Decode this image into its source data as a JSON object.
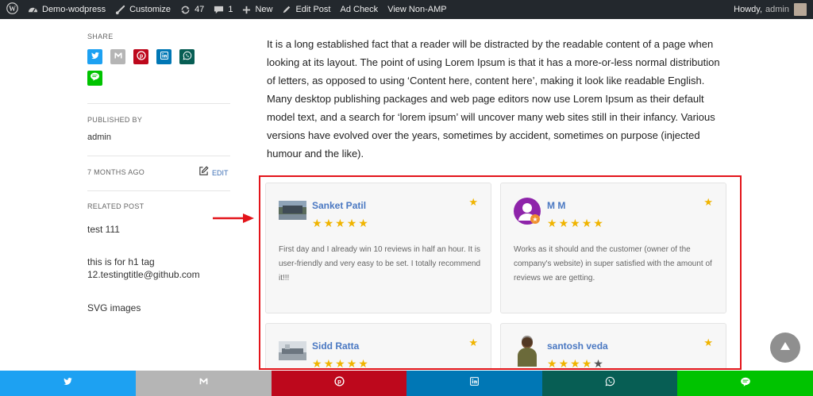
{
  "admin_bar": {
    "site_name": "Demo-wodpress",
    "customize": "Customize",
    "updates_count": "47",
    "comments_count": "1",
    "new": "New",
    "edit_post": "Edit Post",
    "ad_check": "Ad Check",
    "view_non_amp": "View Non-AMP",
    "howdy": "Howdy,",
    "user": "admin"
  },
  "sidebar": {
    "share_label": "SHARE",
    "share_icons": [
      "twitter-icon",
      "gmail-icon",
      "pinterest-icon",
      "linkedin-icon",
      "whatsapp-icon",
      "line-icon"
    ],
    "published_by_label": "PUBLISHED BY",
    "author": "admin",
    "date": "7 MONTHS AGO",
    "edit_label": "EDIT",
    "related_label": "RELATED POST",
    "related_posts": [
      "test 111",
      "this is for h1 tag 12.testingtitle@github.com",
      "SVG images"
    ]
  },
  "article": {
    "body": "It is a long established fact that a reader will be distracted by the readable content of a page when looking at its layout. The point of using Lorem Ipsum is that it has a more-or-less normal distribution of letters, as opposed to using ‘Content here, content here’, making it look like readable English. Many desktop publishing packages and web page editors now use Lorem Ipsum as their default model text, and a search for ‘lorem ipsum’ will uncover many web sites still in their infancy. Various versions have evolved over the years, sometimes by accident, sometimes on purpose (injected humour and the like)."
  },
  "reviews": [
    {
      "name": "Sanket Patil",
      "rating": 5,
      "text": "First day and I already win 10 reviews in half an hour. It is user-friendly and very easy to be set. I totally recommend it!!!"
    },
    {
      "name": "M M",
      "rating": 5,
      "text": "Works as it should and the customer (owner of the company's website) in super satisfied with the amount of reviews we are getting."
    },
    {
      "name": "Sidd Ratta",
      "rating": 5,
      "text": ""
    },
    {
      "name": "santosh veda",
      "rating": 4,
      "text": ""
    }
  ],
  "share_bar": [
    "twitter-icon",
    "gmail-icon",
    "pinterest-icon",
    "linkedin-icon",
    "whatsapp-icon",
    "line-icon"
  ],
  "colors": {
    "admin_bar": "#23282d",
    "twitter": "#1da1f2",
    "gmail": "#b5b5b5",
    "pinterest": "#bd081c",
    "linkedin": "#0077b5",
    "whatsapp": "#075e54",
    "line": "#00c300",
    "star": "#f0b400",
    "highlight_border": "#e3141a",
    "reviewer_name": "#4a78c2"
  }
}
